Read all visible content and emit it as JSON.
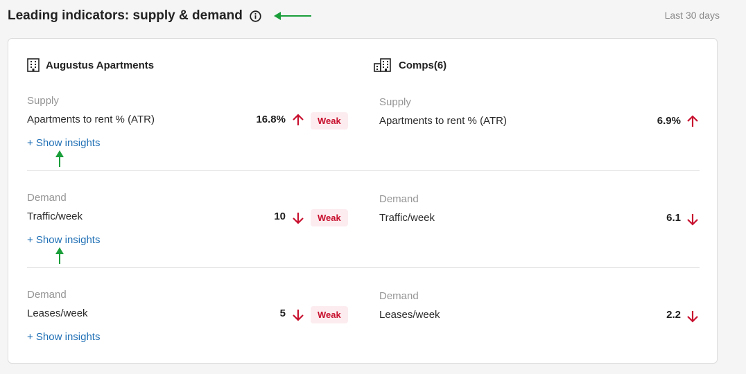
{
  "header": {
    "title": "Leading indicators: supply & demand",
    "period": "Last 30 days"
  },
  "colors": {
    "negative": "#c8102e",
    "link": "#1f6fb5",
    "annotation": "#1a9e3a"
  },
  "property": {
    "name": "Augustus Apartments",
    "icon": "building-icon",
    "rows": [
      {
        "category": "Supply",
        "metric": "Apartments to rent % (ATR)",
        "value": "16.8%",
        "direction": "up",
        "badge": "Weak",
        "link": "+ Show insights"
      },
      {
        "category": "Demand",
        "metric": "Traffic/week",
        "value": "10",
        "direction": "down",
        "badge": "Weak",
        "link": "+ Show insights"
      },
      {
        "category": "Demand",
        "metric": "Leases/week",
        "value": "5",
        "direction": "down",
        "badge": "Weak",
        "link": "+ Show insights"
      }
    ]
  },
  "comps": {
    "name": "Comps(6)",
    "icon": "buildings-icon",
    "rows": [
      {
        "category": "Supply",
        "metric": "Apartments to rent % (ATR)",
        "value": "6.9%",
        "direction": "up"
      },
      {
        "category": "Demand",
        "metric": "Traffic/week",
        "value": "6.1",
        "direction": "down"
      },
      {
        "category": "Demand",
        "metric": "Leases/week",
        "value": "2.2",
        "direction": "down"
      }
    ]
  }
}
